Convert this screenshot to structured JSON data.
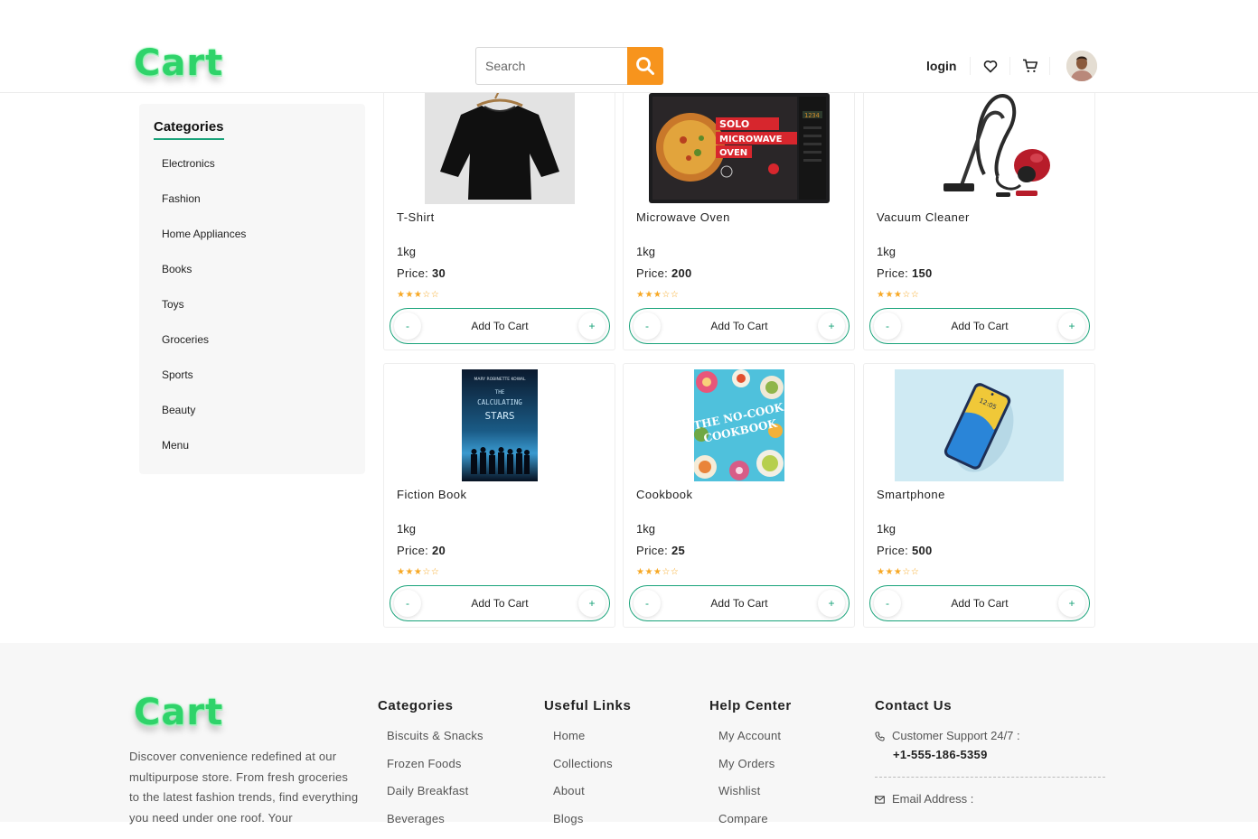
{
  "header": {
    "logo": "Cart",
    "search_placeholder": "Search",
    "login_label": "login"
  },
  "sidebar": {
    "title": "Categories",
    "items": [
      "Electronics",
      "Fashion",
      "Home Appliances",
      "Books",
      "Toys",
      "Groceries",
      "Sports",
      "Beauty",
      "Menu"
    ]
  },
  "products": [
    {
      "name": "T-Shirt",
      "weight": "1kg",
      "price_label": "Price:",
      "price": "30",
      "stars": "★★★☆☆",
      "cart_label": "Add To Cart",
      "minus": "-",
      "plus": "+",
      "image": "tshirt"
    },
    {
      "name": "Microwave Oven",
      "weight": "1kg",
      "price_label": "Price:",
      "price": "200",
      "stars": "★★★☆☆",
      "cart_label": "Add To Cart",
      "minus": "-",
      "plus": "+",
      "image": "microwave"
    },
    {
      "name": "Vacuum Cleaner",
      "weight": "1kg",
      "price_label": "Price:",
      "price": "150",
      "stars": "★★★☆☆",
      "cart_label": "Add To Cart",
      "minus": "-",
      "plus": "+",
      "image": "vacuum"
    },
    {
      "name": "Fiction Book",
      "weight": "1kg",
      "price_label": "Price:",
      "price": "20",
      "stars": "★★★☆☆",
      "cart_label": "Add To Cart",
      "minus": "-",
      "plus": "+",
      "image": "fiction-book"
    },
    {
      "name": "Cookbook",
      "weight": "1kg",
      "price_label": "Price:",
      "price": "25",
      "stars": "★★★☆☆",
      "cart_label": "Add To Cart",
      "minus": "-",
      "plus": "+",
      "image": "cookbook"
    },
    {
      "name": "Smartphone",
      "weight": "1kg",
      "price_label": "Price:",
      "price": "500",
      "stars": "★★★☆☆",
      "cart_label": "Add To Cart",
      "minus": "-",
      "plus": "+",
      "image": "smartphone"
    }
  ],
  "product_images": {
    "microwave_text": [
      "SOLO",
      "MICROWAVE",
      "OVEN"
    ],
    "microwave_display": "1234",
    "book_author": "MARY ROBINETTE KOWAL",
    "book_title": [
      "THE",
      "CALCULATING",
      "STARS"
    ],
    "cookbook_title": [
      "THE NO-COOK",
      "COOKBOOK"
    ],
    "phone_time": "12:05"
  },
  "footer": {
    "logo": "Cart",
    "description": "Discover convenience redefined at our multipurpose store. From fresh groceries to the latest fashion trends, find everything you need under one roof. Your",
    "categories": {
      "title": "Categories",
      "items": [
        "Biscuits & Snacks",
        "Frozen Foods",
        "Daily Breakfast",
        "Beverages"
      ]
    },
    "useful_links": {
      "title": "Useful Links",
      "items": [
        "Home",
        "Collections",
        "About",
        "Blogs"
      ]
    },
    "help_center": {
      "title": "Help Center",
      "items": [
        "My Account",
        "My Orders",
        "Wishlist",
        "Compare"
      ]
    },
    "contact": {
      "title": "Contact Us",
      "support_label": "Customer Support 24/7 :",
      "phone": "+1-555-186-5359",
      "email_label": "Email Address :"
    }
  },
  "colors": {
    "accent_green": "#19a37a",
    "search_orange": "#f7941d",
    "star_gold": "#f7a824",
    "logo_green": "#2fd36a"
  }
}
